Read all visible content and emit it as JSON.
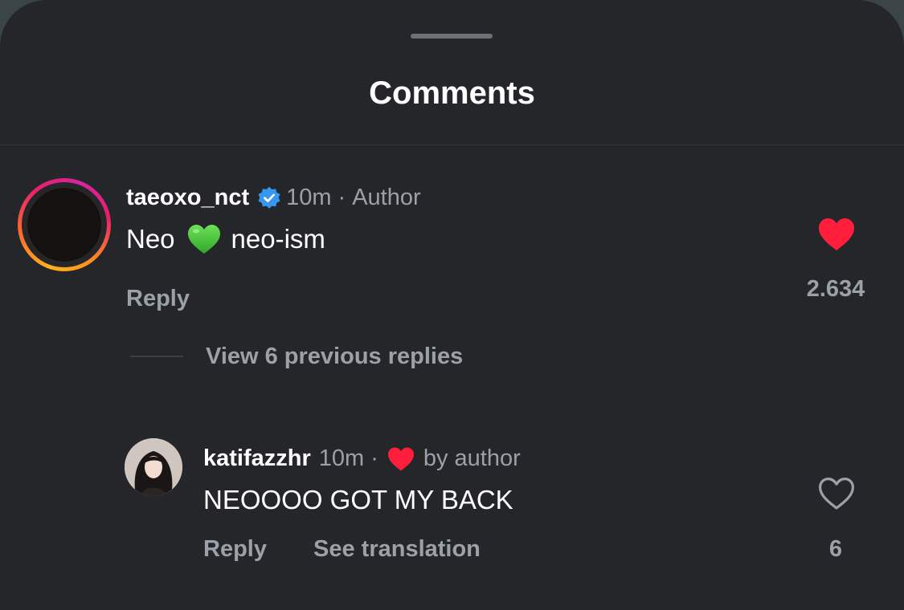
{
  "sheet": {
    "title": "Comments"
  },
  "comments": [
    {
      "username": "taeoxo_nct",
      "verified": true,
      "time": "10m",
      "separator": "·",
      "tag": "Author",
      "text_before": "Neo",
      "emoji": "green-heart",
      "text_after": "neo-ism",
      "reply_label": "Reply",
      "liked": true,
      "like_count": "2.634",
      "view_replies_label": "View 6 previous replies"
    },
    {
      "username": "katifazzhr",
      "time": "10m",
      "separator": "·",
      "liked_by_label": "by author",
      "text": "NEOOOO GOT MY BACK",
      "reply_label": "Reply",
      "translate_label": "See translation",
      "liked": false,
      "like_count": "6"
    }
  ],
  "colors": {
    "background": "#25262a",
    "primary_text": "#ffffff",
    "secondary_text": "#9aa1a8",
    "like_red": "#ff1f3d",
    "verified_blue": "#3797f0",
    "emoji_green": "#4cd137"
  }
}
